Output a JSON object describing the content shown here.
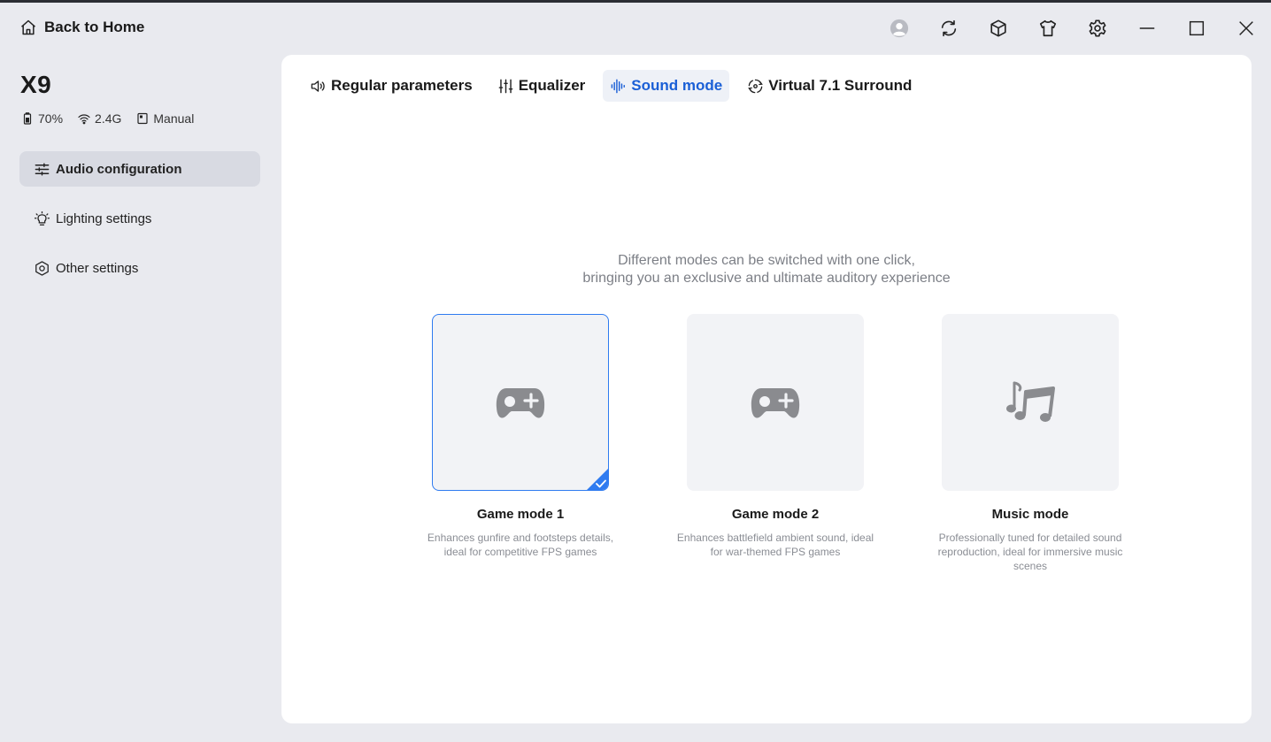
{
  "window": {
    "back_label": "Back to Home",
    "accent_color": "#1a5fd6",
    "icons": [
      "home-icon",
      "user-avatar-icon",
      "sync-icon",
      "cube-icon",
      "shirt-icon",
      "gear-icon",
      "minimize-icon",
      "maximize-icon",
      "close-icon"
    ]
  },
  "device": {
    "name": "X9",
    "battery": "70%",
    "connection": "2.4G",
    "mode": "Manual"
  },
  "sidebar": {
    "items": [
      {
        "label": "Audio configuration",
        "icon": "sliders-icon",
        "active": true
      },
      {
        "label": "Lighting settings",
        "icon": "bulb-icon",
        "active": false
      },
      {
        "label": "Other settings",
        "icon": "hexagon-gear-icon",
        "active": false
      }
    ]
  },
  "tabs": [
    {
      "label": "Regular parameters",
      "icon": "speaker-icon",
      "active": false
    },
    {
      "label": "Equalizer",
      "icon": "equalizer-icon",
      "active": false
    },
    {
      "label": "Sound mode",
      "icon": "waveform-icon",
      "active": true
    },
    {
      "label": "Virtual 7.1 Surround",
      "icon": "surround-icon",
      "active": false
    }
  ],
  "main": {
    "intro_line1": "Different modes can be switched with one click,",
    "intro_line2": "bringing you an exclusive and ultimate auditory experience",
    "modes": [
      {
        "name": "Game mode 1",
        "desc": "Enhances gunfire and footsteps details, ideal for competitive FPS games",
        "icon": "gamepad-icon",
        "selected": true
      },
      {
        "name": "Game mode 2",
        "desc": "Enhances battlefield ambient sound, ideal for war-themed FPS games",
        "icon": "gamepad-icon",
        "selected": false
      },
      {
        "name": "Music mode",
        "desc": "Professionally tuned for detailed sound reproduction, ideal for immersive music scenes",
        "icon": "music-notes-icon",
        "selected": false
      }
    ]
  }
}
